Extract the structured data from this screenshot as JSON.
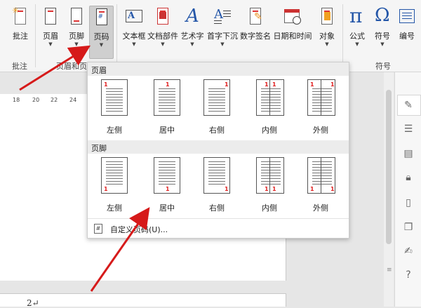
{
  "ribbon": {
    "buttons": [
      {
        "label": "批注",
        "icon": "comment-icon"
      },
      {
        "label": "页眉",
        "icon": "header-icon"
      },
      {
        "label": "页脚",
        "icon": "footer-icon"
      },
      {
        "label": "页码",
        "icon": "page-number-icon"
      },
      {
        "label": "文本框",
        "icon": "text-box-icon"
      },
      {
        "label": "文档部件",
        "icon": "document-parts-icon"
      },
      {
        "label": "艺术字",
        "icon": "wordart-icon"
      },
      {
        "label": "首字下沉",
        "icon": "drop-cap-icon"
      },
      {
        "label": "数字签名",
        "icon": "digital-signature-icon"
      },
      {
        "label": "日期和时间",
        "icon": "date-time-icon"
      },
      {
        "label": "对象",
        "icon": "object-icon"
      },
      {
        "label": "公式",
        "icon": "equation-icon"
      },
      {
        "label": "符号",
        "icon": "symbol-icon"
      },
      {
        "label": "编号",
        "icon": "numbering-icon"
      }
    ],
    "group_labels": {
      "comments": "批注",
      "header_footer": "页眉和页",
      "symbols": "符号"
    },
    "icon_glyphs": {
      "page_number": "#",
      "text_box": "A",
      "wordart": "A",
      "drop_cap": "A",
      "equation": "π",
      "symbol": "Ω",
      "numbering": "1"
    }
  },
  "ruler": {
    "ticks": [
      "18",
      "20",
      "22",
      "24"
    ]
  },
  "document": {
    "page_number": "2↵"
  },
  "dropdown": {
    "header_section": {
      "title": "页眉",
      "options": [
        {
          "label": "左侧",
          "num": "1"
        },
        {
          "label": "居中",
          "num": "1"
        },
        {
          "label": "右侧",
          "num": "1"
        },
        {
          "label": "内侧",
          "num": "1"
        },
        {
          "label": "外侧",
          "num": "1"
        }
      ]
    },
    "footer_section": {
      "title": "页脚",
      "options": [
        {
          "label": "左侧",
          "num": "1"
        },
        {
          "label": "居中",
          "num": "1"
        },
        {
          "label": "右侧",
          "num": "1"
        },
        {
          "label": "内侧",
          "num": "1"
        },
        {
          "label": "外侧",
          "num": "1"
        }
      ]
    },
    "custom": {
      "label": "自定义页码(U)...",
      "icon_glyph": "#"
    }
  },
  "right_panel": {
    "icons": [
      "pen-icon",
      "settings-sliders-icon",
      "layers-icon",
      "lock-icon",
      "save-icon",
      "copy-icon",
      "edit-icon",
      "help-icon"
    ]
  },
  "colors": {
    "accent_red": "#e02020",
    "arrow_red": "#d61a1a",
    "ribbon_bg": "#f5f5f5",
    "icon_blue": "#2456a8"
  }
}
